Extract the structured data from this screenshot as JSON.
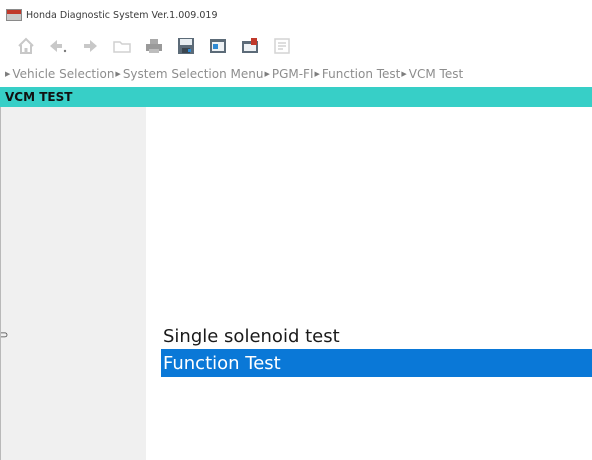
{
  "window": {
    "title": "Honda Diagnostic System Ver.1.009.019",
    "app_icon": "hds-app-icon"
  },
  "toolbar": {
    "buttons": [
      {
        "name": "home-button",
        "icon": "home-icon",
        "enabled": false
      },
      {
        "name": "back-button",
        "icon": "arrow-left-icon",
        "enabled": false
      },
      {
        "name": "forward-button",
        "icon": "arrow-right-icon",
        "enabled": false
      },
      {
        "name": "folder-button",
        "icon": "folder-icon",
        "enabled": false
      },
      {
        "name": "print-button",
        "icon": "printer-icon",
        "enabled": true
      },
      {
        "name": "save-button",
        "icon": "disk-save-icon",
        "enabled": true
      },
      {
        "name": "screen-button",
        "icon": "screen-window-icon",
        "enabled": true
      },
      {
        "name": "data-button",
        "icon": "window-note-icon",
        "enabled": true
      },
      {
        "name": "snapshot-button",
        "icon": "snapshot-icon",
        "enabled": false
      }
    ]
  },
  "breadcrumb": {
    "items": [
      "Vehicle Selection",
      "System Selection Menu",
      "PGM-FI",
      "Function Test",
      "VCM Test"
    ]
  },
  "section": {
    "title": "VCM TEST",
    "color": "#37cfc7"
  },
  "left_pane": {
    "edge_mark": "⊃"
  },
  "menu": {
    "items": [
      {
        "label": "Single solenoid test",
        "selected": false
      },
      {
        "label": "Function Test",
        "selected": true
      }
    ],
    "selected_color": "#0a78d7"
  }
}
